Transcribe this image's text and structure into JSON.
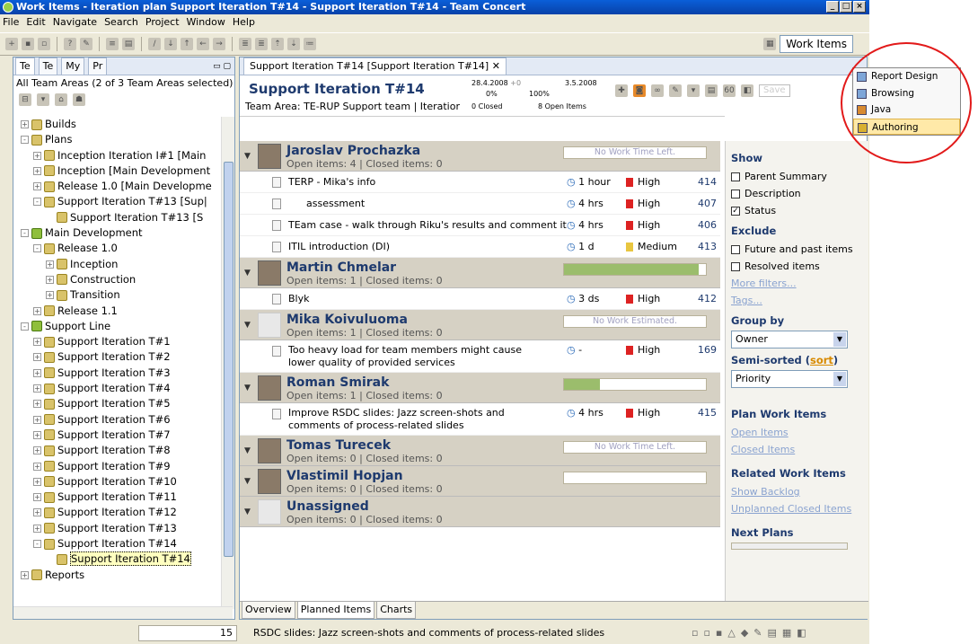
{
  "window": {
    "title": "Work Items - Iteration plan Support Iteration T#14 - Support Iteration T#14 - Team Concert"
  },
  "menu": [
    "File",
    "Edit",
    "Navigate",
    "Search",
    "Project",
    "Window",
    "Help"
  ],
  "perspective": {
    "label": "Work Items"
  },
  "left": {
    "tabs": [
      "Te",
      "Te",
      "My",
      "Pr"
    ],
    "header": "All Team Areas (2 of 3 Team Areas selected)",
    "tree": [
      {
        "label": "Builds",
        "indent": 1,
        "pm": "+"
      },
      {
        "label": "Plans",
        "indent": 1,
        "pm": "-"
      },
      {
        "label": "Inception Iteration I#1 [Main",
        "indent": 2,
        "pm": "+"
      },
      {
        "label": "Inception [Main Development",
        "indent": 2,
        "pm": "+"
      },
      {
        "label": "Release 1.0 [Main Developme",
        "indent": 2,
        "pm": "+"
      },
      {
        "label": "Support Iteration T#13 [Sup|",
        "indent": 2,
        "pm": "-"
      },
      {
        "label": "Support Iteration T#13 [S",
        "indent": 3,
        "pm": ""
      },
      {
        "label": "Main Development",
        "indent": 1,
        "pm": "-",
        "main": true
      },
      {
        "label": "Release 1.0",
        "indent": 2,
        "pm": "-"
      },
      {
        "label": "Inception",
        "indent": 3,
        "pm": "+"
      },
      {
        "label": "Construction",
        "indent": 3,
        "pm": "+"
      },
      {
        "label": "Transition",
        "indent": 3,
        "pm": "+"
      },
      {
        "label": "Release 1.1",
        "indent": 2,
        "pm": "+"
      },
      {
        "label": "Support Line",
        "indent": 1,
        "pm": "-",
        "main": true
      },
      {
        "label": "Support Iteration T#1",
        "indent": 2,
        "pm": "+"
      },
      {
        "label": "Support Iteration T#2",
        "indent": 2,
        "pm": "+"
      },
      {
        "label": "Support Iteration T#3",
        "indent": 2,
        "pm": "+"
      },
      {
        "label": "Support Iteration T#4",
        "indent": 2,
        "pm": "+"
      },
      {
        "label": "Support Iteration T#5",
        "indent": 2,
        "pm": "+"
      },
      {
        "label": "Support Iteration T#6",
        "indent": 2,
        "pm": "+"
      },
      {
        "label": "Support Iteration T#7",
        "indent": 2,
        "pm": "+"
      },
      {
        "label": "Support Iteration T#8",
        "indent": 2,
        "pm": "+"
      },
      {
        "label": "Support Iteration T#9",
        "indent": 2,
        "pm": "+"
      },
      {
        "label": "Support Iteration T#10",
        "indent": 2,
        "pm": "+"
      },
      {
        "label": "Support Iteration T#11",
        "indent": 2,
        "pm": "+"
      },
      {
        "label": "Support Iteration T#12",
        "indent": 2,
        "pm": "+"
      },
      {
        "label": "Support Iteration T#13",
        "indent": 2,
        "pm": "+"
      },
      {
        "label": "Support Iteration T#14",
        "indent": 2,
        "pm": "-"
      },
      {
        "label": "Support Iteration T#14",
        "indent": 3,
        "pm": "",
        "selected": true
      },
      {
        "label": "Reports",
        "indent": 1,
        "pm": "+"
      }
    ]
  },
  "editor": {
    "tab": "Support Iteration T#14 [Support Iteration T#14]",
    "title": "Support Iteration T#14",
    "team_area": "Team Area: TE-RUP Support team | Iteratior",
    "date_start": "28.4.2008",
    "date_delta": "+0",
    "date_end": "3.5.2008",
    "pct_done": "0%",
    "pct_total": "100%",
    "closed_count": "0 Closed",
    "open_count": "8 Open Items",
    "save_label": "Save"
  },
  "groups": [
    {
      "name": "Jaroslav Prochazka",
      "counts": "Open items: 4 | Closed items: 0",
      "bar_text": "No Work Time Left.",
      "fill": 0,
      "items": [
        {
          "summary": "TERP - Mika's info",
          "estimate": "1 hour",
          "priority": "High",
          "id": "414"
        },
        {
          "summary": "assessment",
          "estimate": "4 hrs",
          "priority": "High",
          "id": "407",
          "indent": true
        },
        {
          "summary": "TEam case - walk through Riku's results and comment it",
          "estimate": "4 hrs",
          "priority": "High",
          "id": "406"
        },
        {
          "summary": "ITIL introduction (DI)",
          "estimate": "1 d",
          "priority": "Medium",
          "id": "413"
        }
      ]
    },
    {
      "name": "Martin Chmelar",
      "counts": "Open items: 1 | Closed items: 0",
      "bar_text": "",
      "fill": 0.95,
      "items": [
        {
          "summary": "Blyk",
          "estimate": "3 ds",
          "priority": "High",
          "id": "412"
        }
      ]
    },
    {
      "name": "Mika Koivuluoma",
      "counts": "Open items: 1 | Closed items: 0",
      "bar_text": "No Work Estimated.",
      "fill": 0,
      "blank": true,
      "items": [
        {
          "summary": "Too heavy load for team members might cause lower quality of provided services",
          "estimate": "-",
          "priority": "High",
          "id": "169",
          "two": true
        }
      ]
    },
    {
      "name": "Roman Smirak",
      "counts": "Open items: 1 | Closed items: 0",
      "bar_text": "",
      "fill": 0.25,
      "items": [
        {
          "summary": "Improve RSDC slides: Jazz screen-shots and comments of process-related slides",
          "estimate": "4 hrs",
          "priority": "High",
          "id": "415",
          "two": true
        }
      ]
    },
    {
      "name": "Tomas Turecek",
      "counts": "Open items: 0 | Closed items: 0",
      "bar_text": "No Work Time Left.",
      "fill": 0,
      "items": []
    },
    {
      "name": "Vlastimil Hopjan",
      "counts": "Open items: 0 | Closed items: 0",
      "bar_text": "",
      "fill": 0,
      "items": []
    },
    {
      "name": "Unassigned",
      "counts": "Open items: 0 | Closed items: 0",
      "bar_text": null,
      "fill": 0,
      "blank": true,
      "items": []
    }
  ],
  "right": {
    "show_title": "Show",
    "show": [
      {
        "label": "Parent Summary",
        "checked": false
      },
      {
        "label": "Description",
        "checked": false
      },
      {
        "label": "Status",
        "checked": true
      }
    ],
    "exclude_title": "Exclude",
    "exclude": [
      {
        "label": "Future and past items",
        "checked": false
      },
      {
        "label": "Resolved items",
        "checked": false
      }
    ],
    "more_filters": "More filters...",
    "tags": "Tags...",
    "group_by_title": "Group by",
    "group_by_value": "Owner",
    "semi_sorted_title": "Semi-sorted (",
    "sort_link": "sort",
    "semi_sorted_close": ")",
    "sort_value": "Priority",
    "plan_title": "Plan Work Items",
    "open_items": "Open Items",
    "closed_items": "Closed Items",
    "related_title": "Related Work Items",
    "show_backlog": "Show Backlog",
    "unplanned": "Unplanned Closed Items",
    "next_plans": "Next Plans"
  },
  "bottom_tabs": [
    "Overview",
    "Planned Items",
    "Charts"
  ],
  "status": {
    "page": "15",
    "message": "RSDC slides: Jazz screen-shots and comments of process-related slides"
  },
  "dropdown": {
    "items": [
      "Report Design",
      "Browsing",
      "Java",
      "Authoring"
    ],
    "highlighted": 3
  }
}
